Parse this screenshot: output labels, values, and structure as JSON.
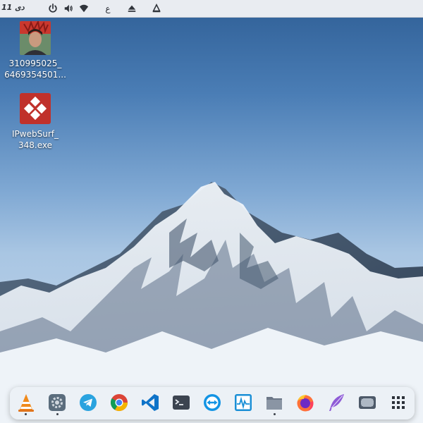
{
  "top_panel": {
    "clock": "11 دی",
    "tray": [
      {
        "icon": "power-icon"
      },
      {
        "icon": "volume-icon"
      },
      {
        "icon": "wifi-icon"
      },
      {
        "icon": "keyboard-layout-indicator",
        "label": "ع"
      },
      {
        "icon": "eject-icon"
      },
      {
        "icon": "launcher-icon"
      }
    ]
  },
  "desktop_icons": [
    {
      "label": "310995025_\n6469354501...",
      "kind": "photo"
    },
    {
      "label": "IPwebSurf_\n348.exe",
      "kind": "exe"
    }
  ],
  "dock": {
    "apps": [
      {
        "name": "vlc",
        "icon": "vlc-icon",
        "color": "#f08a1b"
      },
      {
        "name": "settings",
        "icon": "settings-icon",
        "color": "#5b6d7d"
      },
      {
        "name": "telegram",
        "icon": "telegram-icon",
        "color": "#2aa3df"
      },
      {
        "name": "chrome",
        "icon": "chrome-icon",
        "color": "#db4437"
      },
      {
        "name": "vscode",
        "icon": "vscode-icon",
        "color": "#0e73c8"
      },
      {
        "name": "terminal",
        "icon": "terminal-icon",
        "color": "#3c4450"
      },
      {
        "name": "teamviewer",
        "icon": "teamviewer-icon",
        "color": "#1394e4"
      },
      {
        "name": "system-monitor",
        "icon": "system-monitor-icon",
        "color": "#1a8fd6"
      },
      {
        "name": "files",
        "icon": "files-icon",
        "color": "#6c7787"
      },
      {
        "name": "firefox",
        "icon": "firefox-icon",
        "color": "#ff7139"
      },
      {
        "name": "quill-editor",
        "icon": "quill-icon",
        "color": "#8e5bd6"
      },
      {
        "name": "screenshot",
        "icon": "screenshot-icon",
        "color": "#4d5968"
      },
      {
        "name": "app-grid",
        "icon": "app-grid-icon",
        "color": "#2b3038"
      }
    ]
  }
}
